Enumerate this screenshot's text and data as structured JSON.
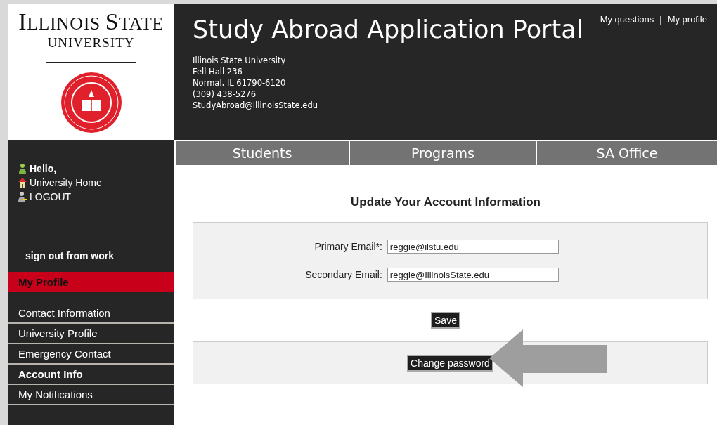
{
  "logo": {
    "line_1": "ILLINOIS STATE",
    "line_2": "UNIVERSITY"
  },
  "header": {
    "title": "Study Abroad Application Portal",
    "address_lines": [
      "Illinois State University",
      "Fell Hall 236",
      "Normal, IL 61790-6120",
      "(309) 438-5276",
      "StudyAbroad@IllinoisState.edu"
    ],
    "top_links": [
      "My questions",
      "My profile"
    ],
    "separator": "|"
  },
  "nav_tabs": [
    {
      "label": "Students"
    },
    {
      "label": "Programs"
    },
    {
      "label": "SA Office"
    }
  ],
  "sidebar": {
    "user_links": [
      {
        "kind": "user",
        "label": "Hello,"
      },
      {
        "kind": "home",
        "label": "University Home"
      },
      {
        "kind": "logout",
        "label": "LOGOUT"
      }
    ],
    "sign_out": "sign out from work",
    "section": "My Profile",
    "items": [
      {
        "label": "Contact Information",
        "selected": false
      },
      {
        "label": "University Profile",
        "selected": false
      },
      {
        "label": "Emergency Contact",
        "selected": false
      },
      {
        "label": "Account Info",
        "selected": true
      },
      {
        "label": "My Notifications",
        "selected": false
      }
    ]
  },
  "page": {
    "heading": "Update Your Account Information",
    "fields": [
      {
        "label": "Primary Email*:",
        "value": "reggie@ilstu.edu"
      },
      {
        "label": "Secondary Email:",
        "value": "reggie@IllinoisState.edu"
      }
    ],
    "save_button": "Save",
    "change_password_button": "Change password"
  }
}
